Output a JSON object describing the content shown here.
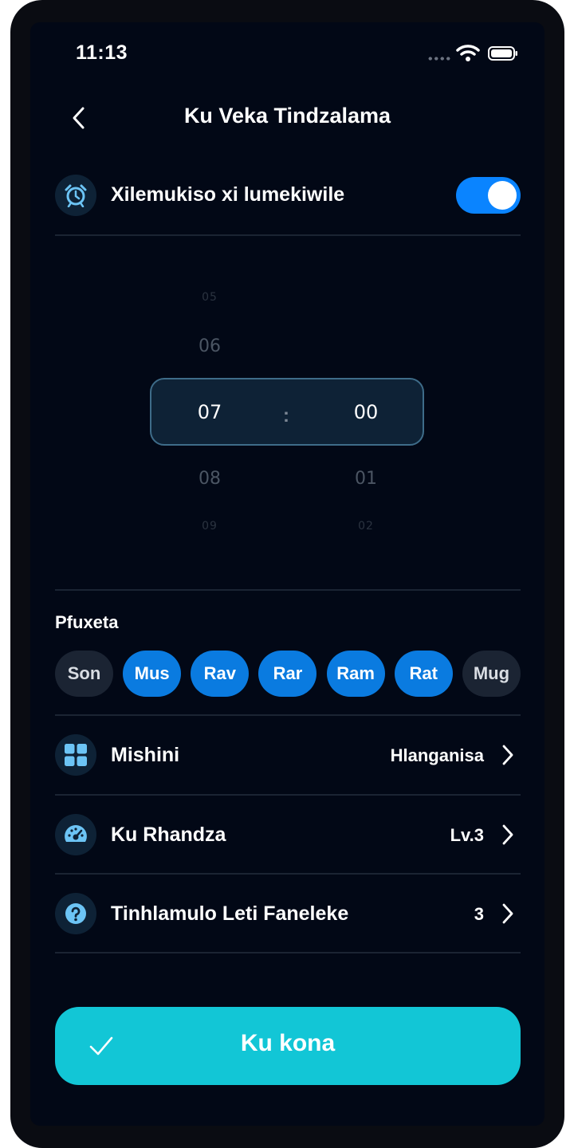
{
  "status_bar": {
    "time": "11:13"
  },
  "header": {
    "title": "Ku Veka Tindzalama"
  },
  "alarm": {
    "label": "Xilemukiso xi lumekiwile",
    "enabled": true
  },
  "time_picker": {
    "hours": [
      "05",
      "06",
      "07",
      "08",
      "09"
    ],
    "minutes": [
      "01",
      "00",
      "02"
    ],
    "selected_hour": "07",
    "selected_minute": "00",
    "separator": ":",
    "hour_above": "06",
    "hour_above_far": "05",
    "hour_below": "08",
    "hour_below_far": "09",
    "minute_below": "01",
    "minute_below_far": "02"
  },
  "repeat": {
    "label": "Pfuxeta",
    "days": [
      {
        "label": "Son",
        "selected": false
      },
      {
        "label": "Mus",
        "selected": true
      },
      {
        "label": "Rav",
        "selected": true
      },
      {
        "label": "Rar",
        "selected": true
      },
      {
        "label": "Ram",
        "selected": true
      },
      {
        "label": "Rat",
        "selected": true
      },
      {
        "label": "Mug",
        "selected": false
      }
    ]
  },
  "settings": [
    {
      "label": "Mishini",
      "value": "Hlanganisa",
      "icon": "grid-icon"
    },
    {
      "label": "Ku Rhandza",
      "value": "Lv.3",
      "icon": "gauge-icon"
    },
    {
      "label": "Tinhlamulo Leti Faneleke",
      "value": "3",
      "icon": "question-icon"
    }
  ],
  "cta": {
    "label": "Ku kona"
  },
  "colors": {
    "accent": "#0a7be0",
    "cta": "#12c6d6",
    "background": "#020816",
    "icon": "#6cc4f5"
  }
}
